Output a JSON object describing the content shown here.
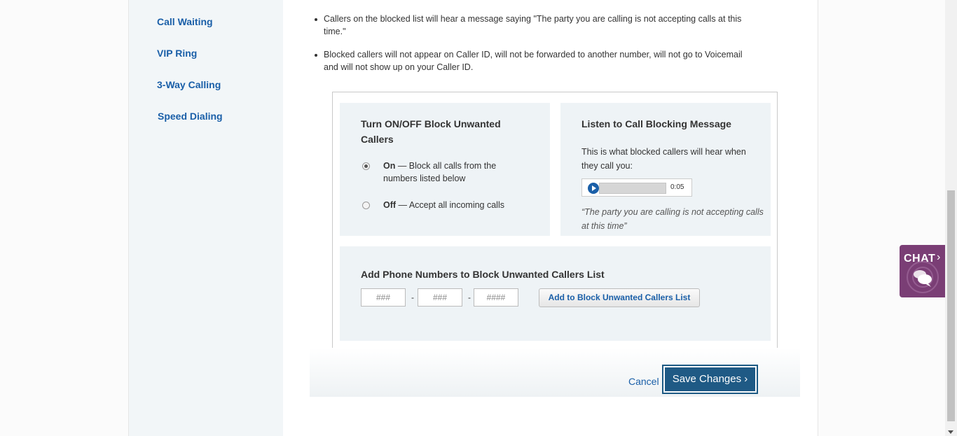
{
  "sidebar": {
    "items": [
      {
        "label": "Call Waiting"
      },
      {
        "label": "VIP Ring"
      },
      {
        "label": "3-Way Calling"
      },
      {
        "label": "Speed Dialing"
      }
    ]
  },
  "info_bullets": [
    "Callers on the blocked list will hear a message saying \"The party you are calling is not accepting calls at this time.\"",
    "Blocked callers will not appear on Caller ID, will not be forwarded to another number, will not go to Voicemail and will not show up on your Caller ID."
  ],
  "toggle_panel": {
    "title": "Turn ON/OFF Block Unwanted Callers",
    "on_label": "On",
    "on_text": " — Block all calls from the numbers listed below",
    "off_label": "Off",
    "off_text": " — Accept all incoming calls",
    "selected": "on"
  },
  "message_panel": {
    "title": "Listen to Call Blocking Message",
    "description": "This is what blocked callers will hear when they call you:",
    "audio_duration": "0:05",
    "quote": "“The party you are calling is not accepting calls at this time”"
  },
  "add_panel": {
    "title": "Add Phone Numbers to Block Unwanted Callers List",
    "area_placeholder": "###",
    "prefix_placeholder": "###",
    "line_placeholder": "####",
    "separator": "-",
    "button_label": "Add to Block Unwanted Callers List"
  },
  "actions": {
    "cancel_label": "Cancel",
    "save_label": "Save Changes"
  },
  "chat": {
    "label": "CHAT"
  },
  "colors": {
    "link": "#1a5fa8",
    "panel_bg": "#eef3f6",
    "primary_button": "#1f5a85",
    "chat_bg": "#7a3e75"
  }
}
